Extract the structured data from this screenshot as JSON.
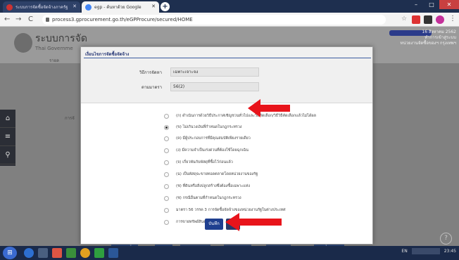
{
  "browser": {
    "tabs": [
      {
        "label": "ระบบการจัดซื้อจัดจ้างภาครัฐ",
        "active": false
      },
      {
        "label": "egp - ค้นหาด้วย Google",
        "active": true
      }
    ],
    "new_tab_glyph": "+",
    "url": "process3.gprocurement.go.th/eGPProcure/secured/HOME",
    "nav": {
      "back": "←",
      "forward": "→",
      "reload": "C"
    },
    "star_glyph": "☆",
    "window_controls": {
      "min": "–",
      "max": "□",
      "close": "✕"
    }
  },
  "site": {
    "title": "ระบบการจัด",
    "subtitle": "Thai Governme",
    "header_right": [
      "16 สิงหาคม 2562",
      "ทำการเข้าสู่ระบบ",
      "หน่วยงานจัดซื้อของฯ กรุงเทพฯ"
    ],
    "left_labels": [
      "รายล",
      "การจั"
    ]
  },
  "sidebar_icons": [
    "home-icon",
    "menu-icon",
    "search-icon"
  ],
  "sidebar_glyphs": [
    "⌂",
    "≡",
    "⚲"
  ],
  "dialog": {
    "title": "เงื่อนไขการจัดซื้อจัดจ้าง",
    "fields": [
      {
        "label": "วิธีการจัดหา",
        "value": "เฉพาะเจาะจง"
      },
      {
        "label": "ตามมาตรา",
        "value": "56(2)"
      }
    ],
    "options": [
      {
        "label": "(ก) ดำเนินการด้วยวิธีประกาศเชิญชวนทั่วไปและวิธีคัดเลือก/วิธีวิธีคัดเลือกแล้วไม่ได้ผล",
        "selected": false
      },
      {
        "label": "(ข) ไม่เกินวงเงินที่กำหนดในกฎกระทรวง",
        "selected": true
      },
      {
        "label": "(ค) มีผู้ประกอบการที่มีคุณสมบัติเพียงรายเดียว",
        "selected": false
      },
      {
        "label": "(ง) มีความจำเป็นเร่งด่วนที่ต้องใช้โดยฉุกเฉิน",
        "selected": false
      },
      {
        "label": "(จ) เกี่ยวพันกับพัสดุที่ซื้อไว้ก่อนแล้ว",
        "selected": false
      },
      {
        "label": "(ฉ) เป็นพัสดุจะขายทอดตลาดโดยหน่วยงานของรัฐ",
        "selected": false
      },
      {
        "label": "(ช) ที่ดินหรือสิ่งปลูกสร้างซึ่งต้องซื้อเฉพาะแห่ง",
        "selected": false
      },
      {
        "label": "(ซ) กรณีอื่นตามที่กำหนดในกฎกระทรวง",
        "selected": false
      },
      {
        "label": "มาตรา 56 วรรค 3 การจัดซื้อจัดจ้างของหน่วยงานรัฐในต่างประเทศ",
        "selected": false
      },
      {
        "label": "การขายทรัพย์สินตามข้อ 93",
        "selected": false
      }
    ],
    "save_label": "บันทึก"
  },
  "bottom_buttons": [
    "บันทึกข้อมูล",
    "บันทึก",
    "ยกเลิกรายการ",
    "ไปหน้าถัดไป",
    "รายงานผล",
    "กลับสู่หน้าหลัก"
  ],
  "help_glyph": "?",
  "taskbar": {
    "start_glyph": "⊞",
    "tray_lang": "EN",
    "clock": "23:45"
  },
  "colors": {
    "arrow": "#e8141b",
    "header_blue": "#2b3b78",
    "save_button": "#1f3f8f"
  }
}
